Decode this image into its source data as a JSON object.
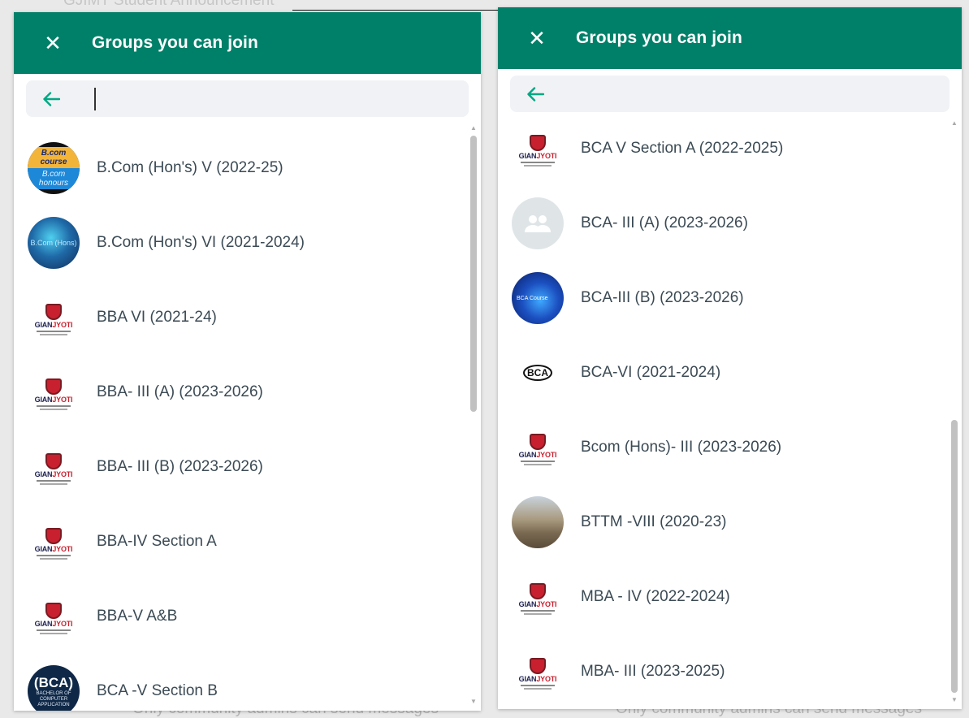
{
  "background": {
    "top_text": "GJIMT Student Announcement",
    "bottom_text": "Only community admins can send messages"
  },
  "colors": {
    "header": "#008069",
    "accent": "#00a884",
    "item_text": "#3b4a54"
  },
  "left_panel": {
    "title": "Groups you can join",
    "search_placeholder": "",
    "items": [
      {
        "name": "B.Com (Hon's) V (2022-25)",
        "avatar_text": [
          "B.com course",
          "B.com honours"
        ]
      },
      {
        "name": "B.Com (Hon's) VI (2021-2024)",
        "avatar_text": [
          "B.Com (Hons)"
        ]
      },
      {
        "name": "BBA VI (2021-24)",
        "avatar_text": [
          "GIAN",
          "JYOTI"
        ]
      },
      {
        "name": "BBA- III (A) (2023-2026)",
        "avatar_text": [
          "GIAN",
          "JYOTI"
        ]
      },
      {
        "name": "BBA- III (B) (2023-2026)",
        "avatar_text": [
          "GIAN",
          "JYOTI"
        ]
      },
      {
        "name": "BBA-IV Section A",
        "avatar_text": [
          "GIAN",
          "JYOTI"
        ]
      },
      {
        "name": "BBA-V A&B",
        "avatar_text": [
          "GIAN",
          "JYOTI"
        ]
      },
      {
        "name": "BCA -V Section B",
        "avatar_text": [
          "(BCA)",
          "BACHELOR OF COMPUTER APPLICATION"
        ]
      }
    ]
  },
  "right_panel": {
    "title": "Groups you can join",
    "search_placeholder": "",
    "items": [
      {
        "name": "BCA V Section A (2022-2025)",
        "avatar_text": [
          "GIAN",
          "JYOTI"
        ]
      },
      {
        "name": "BCA- III (A) (2023-2026)",
        "avatar_text": []
      },
      {
        "name": "BCA-III (B) (2023-2026)",
        "avatar_text": [
          "BCA Course"
        ]
      },
      {
        "name": "BCA-VI (2021-2024)",
        "avatar_text": [
          "BCA"
        ]
      },
      {
        "name": "Bcom (Hons)- III (2023-2026)",
        "avatar_text": [
          "GIAN",
          "JYOTI"
        ]
      },
      {
        "name": "BTTM -VIII (2020-23)",
        "avatar_text": []
      },
      {
        "name": "MBA - IV (2022-2024)",
        "avatar_text": [
          "GIAN",
          "JYOTI"
        ]
      },
      {
        "name": "MBA- III (2023-2025)",
        "avatar_text": [
          "GIAN",
          "JYOTI"
        ]
      }
    ]
  }
}
